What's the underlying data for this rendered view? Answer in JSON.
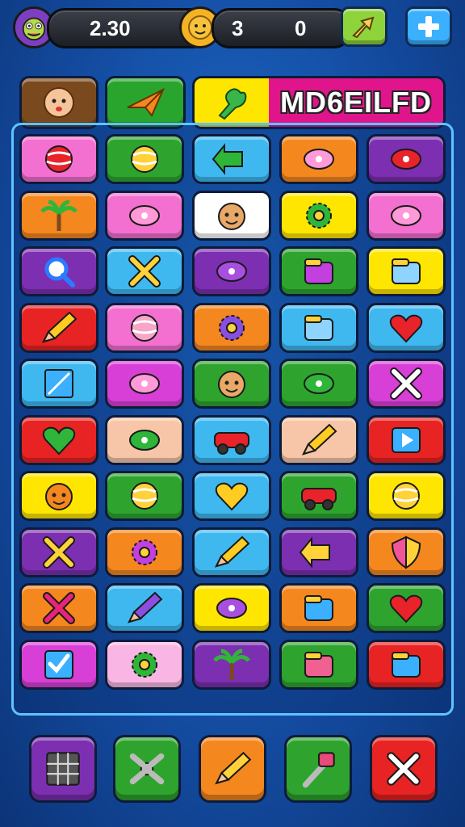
{
  "hud": {
    "coins_value": "2.30",
    "score_value": "3",
    "second_value": "0",
    "coins_icon": "monster-face-icon",
    "score_icon": "sun-face-icon"
  },
  "buttons": {
    "share_icon": "arrow-share-icon",
    "add_icon": "plus-icon"
  },
  "word_banner": {
    "text": "MD6EILFD",
    "icon": "green-hand-icon"
  },
  "top_row": [
    {
      "name": "baby-face-icon",
      "color": "#7a4a1e"
    },
    {
      "name": "paper-plane-icon",
      "color": "#29a52d"
    }
  ],
  "grid": [
    [
      {
        "n": "apple-ball-icon",
        "c": "#f36fd0"
      },
      {
        "n": "rainbow-ball-icon",
        "c": "#2ea42f"
      },
      {
        "n": "green-arrow-icon",
        "c": "#3fb8f0"
      },
      {
        "n": "robot-icon",
        "c": "#f5871f"
      },
      {
        "n": "flag-icon",
        "c": "#7c2fb0"
      }
    ],
    [
      {
        "n": "palm-tree-icon",
        "c": "#f5871f"
      },
      {
        "n": "capsule-icon",
        "c": "#f36fd0"
      },
      {
        "n": "smiley-face-icon",
        "c": "#ffffff"
      },
      {
        "n": "gear-flower-icon",
        "c": "#ffe600"
      },
      {
        "n": "bow-icon",
        "c": "#f36fd0"
      }
    ],
    [
      {
        "n": "magnifier-icon",
        "c": "#7c2fb0"
      },
      {
        "n": "cross-sticks-icon",
        "c": "#3fb8f0"
      },
      {
        "n": "hook-icon",
        "c": "#7c2fb0"
      },
      {
        "n": "bucket-icon",
        "c": "#2ea42f"
      },
      {
        "n": "folder-icon",
        "c": "#ffe600"
      }
    ],
    [
      {
        "n": "crayon-icon",
        "c": "#e82323"
      },
      {
        "n": "striped-ball-icon",
        "c": "#f36fd0"
      },
      {
        "n": "purple-gear-icon",
        "c": "#f5871f"
      },
      {
        "n": "cake-icon",
        "c": "#3fb8f0"
      },
      {
        "n": "heart-icon",
        "c": "#3fb8f0"
      }
    ],
    [
      {
        "n": "square-slash-icon",
        "c": "#3fb8f0"
      },
      {
        "n": "bird-icon",
        "c": "#d83fd6"
      },
      {
        "n": "monkey-face-icon",
        "c": "#2ea42f"
      },
      {
        "n": "s-badge-icon",
        "c": "#2ea42f"
      },
      {
        "n": "x-mark-icon",
        "c": "#d83fd6"
      }
    ],
    [
      {
        "n": "green-heart-icon",
        "c": "#e82323"
      },
      {
        "n": "pickle-icon",
        "c": "#f7c6a8"
      },
      {
        "n": "car-icon",
        "c": "#3fb8f0"
      },
      {
        "n": "brush-icon",
        "c": "#f7c6a8"
      },
      {
        "n": "play-button-icon",
        "c": "#e82323"
      }
    ],
    [
      {
        "n": "fire-face-icon",
        "c": "#ffe600"
      },
      {
        "n": "balloon-icon",
        "c": "#2ea42f"
      },
      {
        "n": "yellow-heart-icon",
        "c": "#3fb8f0"
      },
      {
        "n": "red-car-icon",
        "c": "#2ea42f"
      },
      {
        "n": "color-wheel-icon",
        "c": "#ffe600"
      }
    ],
    [
      {
        "n": "crossed-crayons-icon",
        "c": "#7c2fb0"
      },
      {
        "n": "sun-gear-icon",
        "c": "#f5871f"
      },
      {
        "n": "pencil-icon",
        "c": "#3fb8f0"
      },
      {
        "n": "left-arrow-icon",
        "c": "#7c2fb0"
      },
      {
        "n": "shield-icon",
        "c": "#f5871f"
      }
    ],
    [
      {
        "n": "pink-x-icon",
        "c": "#f5871f"
      },
      {
        "n": "marker-icon",
        "c": "#3fb8f0"
      },
      {
        "n": "purple-star-icon",
        "c": "#ffe600"
      },
      {
        "n": "tube-icon",
        "c": "#f5871f"
      },
      {
        "n": "paint-heart-icon",
        "c": "#2ea42f"
      }
    ],
    [
      {
        "n": "check-box-icon",
        "c": "#d83fd6"
      },
      {
        "n": "flower-icon",
        "c": "#f9b6e4"
      },
      {
        "n": "palm-icon",
        "c": "#7c2fb0"
      },
      {
        "n": "drum-icon",
        "c": "#2ea42f"
      },
      {
        "n": "gift-box-icon",
        "c": "#e82323"
      }
    ]
  ],
  "bottom_bar": [
    {
      "name": "grid-icon",
      "color": "#7c2fb0"
    },
    {
      "name": "shuffle-icon",
      "color": "#2ea42f"
    },
    {
      "name": "knife-icon",
      "color": "#f5871f"
    },
    {
      "name": "hammer-icon",
      "color": "#2ea42f"
    },
    {
      "name": "close-icon",
      "color": "#e82323"
    }
  ]
}
